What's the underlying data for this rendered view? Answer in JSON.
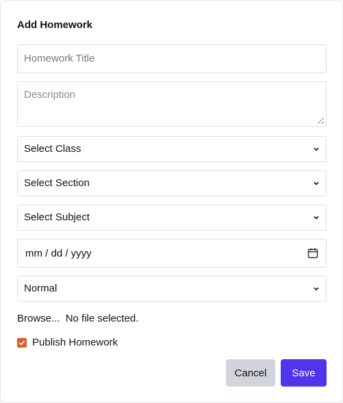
{
  "modal": {
    "title": "Add Homework",
    "homework_title": {
      "placeholder": "Homework Title",
      "value": ""
    },
    "description": {
      "placeholder": "Description",
      "value": ""
    },
    "selects": {
      "class": "Select Class",
      "section": "Select Section",
      "subject": "Select Subject",
      "priority": "Normal"
    },
    "date": {
      "placeholder": "mm / dd / yyyy",
      "icon": "calendar-icon"
    },
    "file": {
      "browse_label": "Browse...",
      "status": "No file selected."
    },
    "publish": {
      "label": "Publish Homework",
      "checked": true,
      "check_color": "#e35a2c"
    },
    "buttons": {
      "cancel": "Cancel",
      "save": "Save"
    },
    "colors": {
      "save_bg": "#4f35ec",
      "cancel_bg": "#d1d5db"
    }
  }
}
